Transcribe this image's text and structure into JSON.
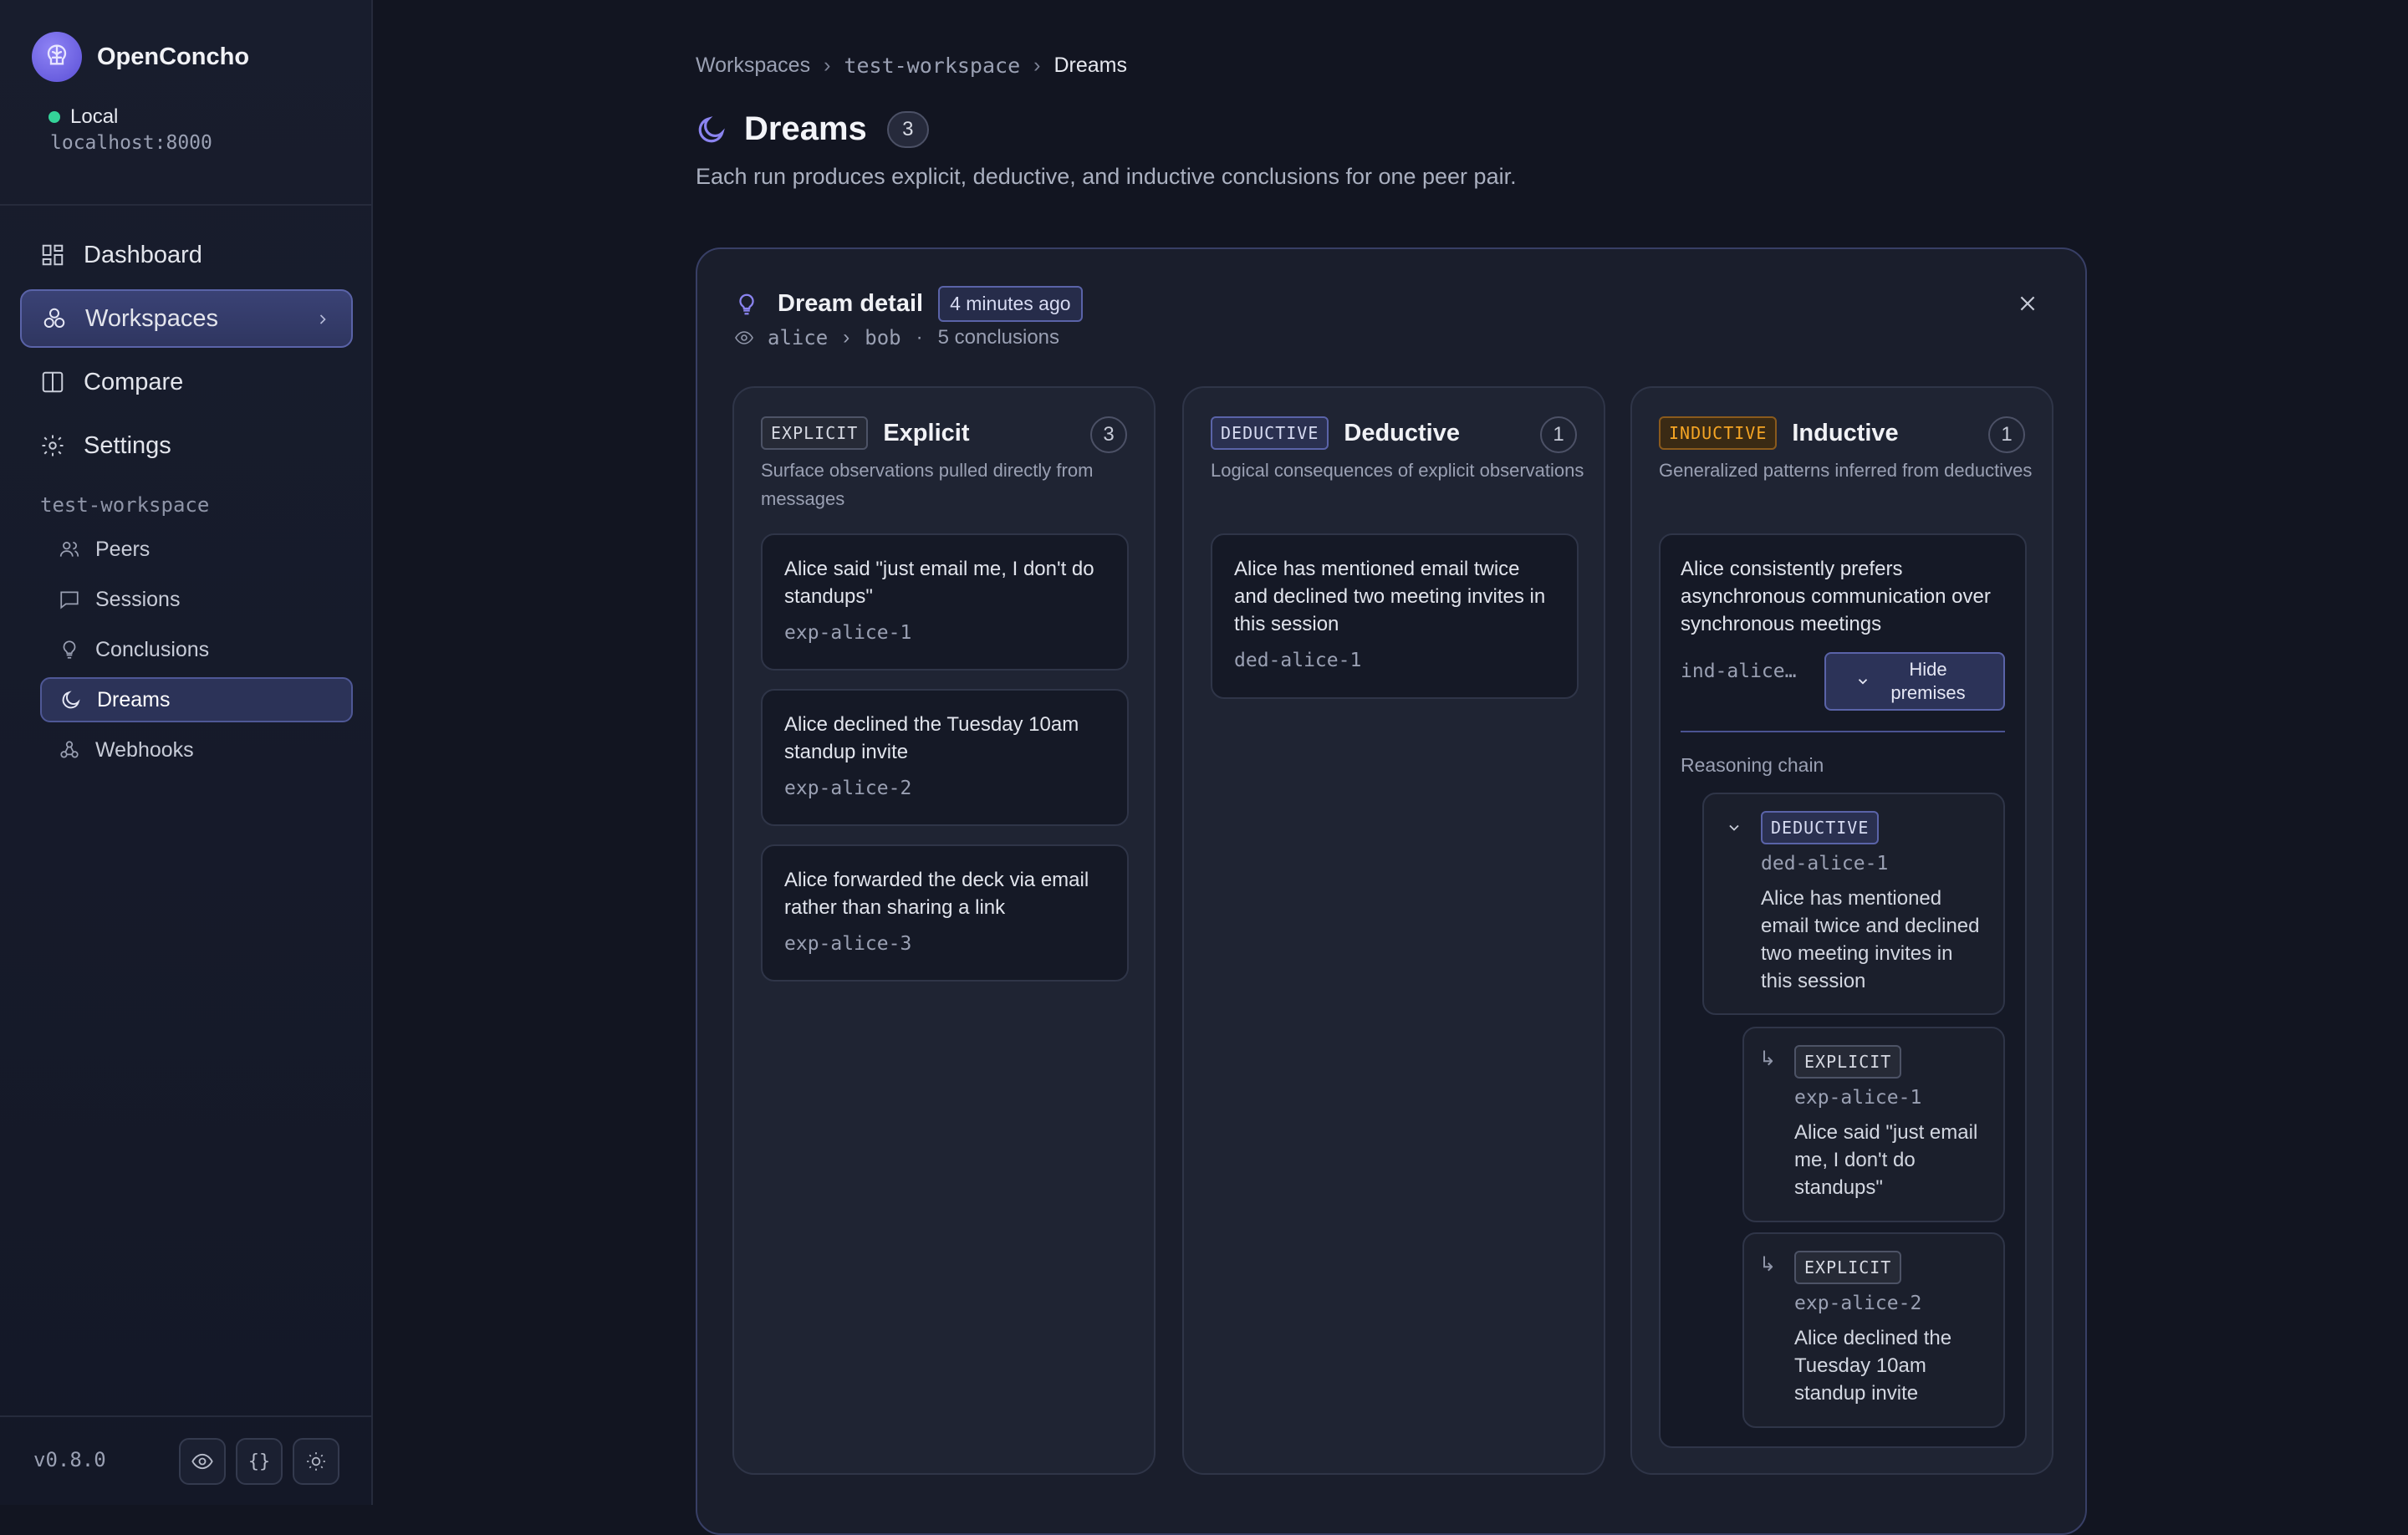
{
  "app": {
    "name": "OpenConcho",
    "status": "Local",
    "host": "localhost:8000",
    "version": "v0.8.0"
  },
  "nav": {
    "dashboard": "Dashboard",
    "workspaces": "Workspaces",
    "compare": "Compare",
    "settings": "Settings"
  },
  "workspace": {
    "name": "test-workspace",
    "items": {
      "peers": "Peers",
      "sessions": "Sessions",
      "conclusions": "Conclusions",
      "dreams": "Dreams",
      "webhooks": "Webhooks"
    }
  },
  "breadcrumb": {
    "root": "Workspaces",
    "workspace": "test-workspace",
    "current": "Dreams"
  },
  "page": {
    "title": "Dreams",
    "count": "3",
    "subtitle": "Each run produces explicit, deductive, and inductive conclusions for one peer pair."
  },
  "detail": {
    "title": "Dream detail",
    "time": "4 minutes ago",
    "observer": "alice",
    "observed": "bob",
    "conclusions": "5 conclusions",
    "meta_sep": "·"
  },
  "columns": {
    "explicit": {
      "tag": "EXPLICIT",
      "title": "Explicit",
      "count": "3",
      "desc": "Surface observations pulled directly from messages",
      "items": [
        {
          "text": "Alice said \"just email me, I don't do standups\"",
          "id": "exp-alice-1"
        },
        {
          "text": "Alice declined the Tuesday 10am standup invite",
          "id": "exp-alice-2"
        },
        {
          "text": "Alice forwarded the deck via email rather than sharing a link",
          "id": "exp-alice-3"
        }
      ]
    },
    "deductive": {
      "tag": "DEDUCTIVE",
      "title": "Deductive",
      "count": "1",
      "desc": "Logical consequences of explicit observations",
      "items": [
        {
          "text": "Alice has mentioned email twice and declined two meeting invites in this session",
          "id": "ded-alice-1"
        }
      ]
    },
    "inductive": {
      "tag": "INDUCTIVE",
      "title": "Inductive",
      "count": "1",
      "desc": "Generalized patterns inferred from deductives",
      "item": {
        "text": "Alice consistently prefers asynchronous communication over synchronous meetings",
        "id": "ind-alice…",
        "hide_label": "Hide premises",
        "chain_label": "Reasoning chain",
        "premise": {
          "tag": "DEDUCTIVE",
          "id": "ded-alice-1",
          "text": "Alice has mentioned email twice and declined two meeting invites in this session",
          "children": [
            {
              "tag": "EXPLICIT",
              "id": "exp-alice-1",
              "text": "Alice said \"just email me, I don't do standups\""
            },
            {
              "tag": "EXPLICIT",
              "id": "exp-alice-2",
              "text": "Alice declined the Tuesday 10am standup invite"
            }
          ]
        }
      }
    }
  },
  "colors": {
    "accent": "#5a63a8",
    "success": "#34d399",
    "inductive": "#f5a524"
  }
}
